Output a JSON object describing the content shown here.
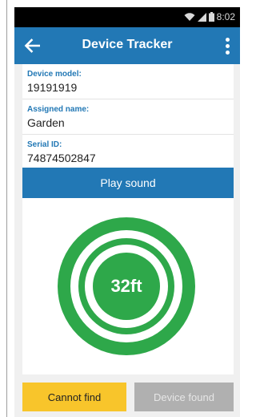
{
  "status_bar": {
    "time": "8:02",
    "icons": [
      "wifi-icon",
      "signal-icon",
      "battery-icon"
    ]
  },
  "app_bar": {
    "title": "Device Tracker",
    "back_icon": "arrow-left-icon",
    "menu_icon": "more-vertical-icon"
  },
  "device_info": [
    {
      "label": "Device model:",
      "value": "19191919"
    },
    {
      "label": "Assigned name:",
      "value": "Garden"
    },
    {
      "label": "Serial ID:",
      "value": "74874502847"
    }
  ],
  "play_sound": {
    "label": "Play sound"
  },
  "radar": {
    "distance": "32ft"
  },
  "actions": {
    "cannot_find": "Cannot find",
    "device_found": "Device found"
  },
  "colors": {
    "primary": "#2278b5",
    "radar_green": "#2ea84a",
    "cannot_find_yellow": "#f8c52b",
    "disabled_gray": "#b0b0b0"
  }
}
